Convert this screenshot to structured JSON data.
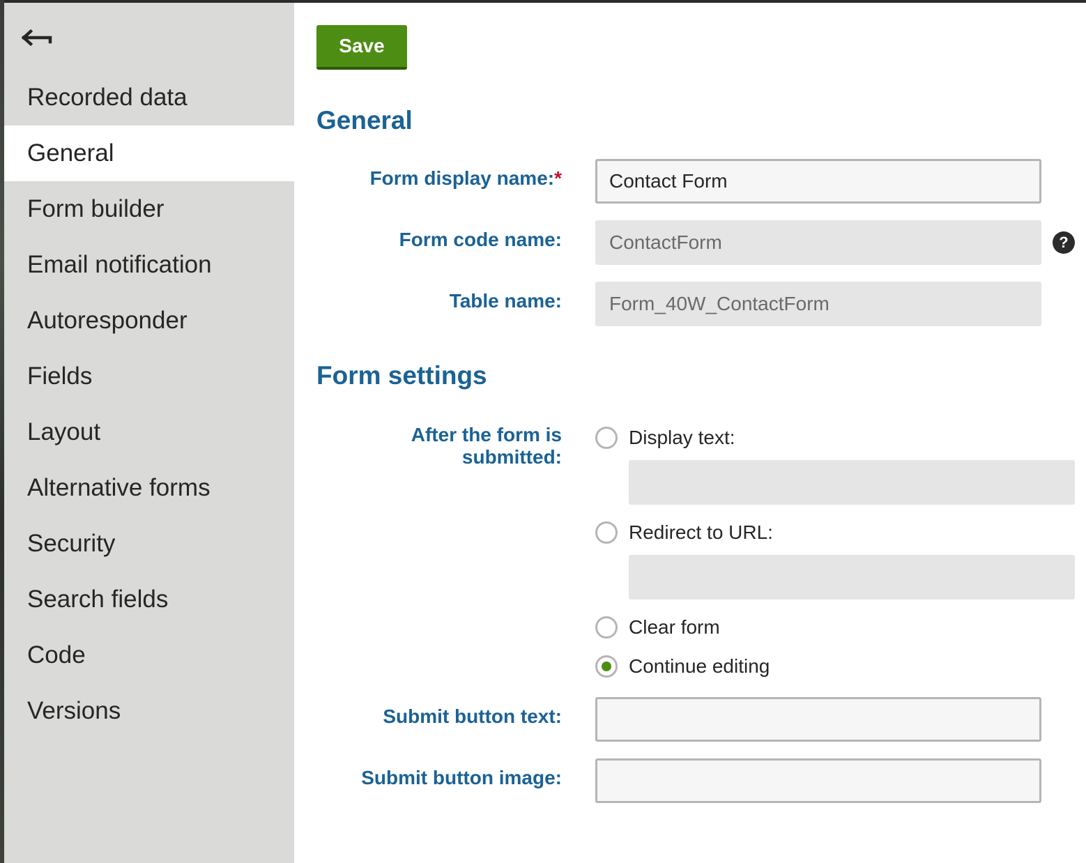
{
  "sidebar": {
    "back_icon": "back-arrow-icon",
    "items": [
      {
        "label": "Recorded data",
        "active": false
      },
      {
        "label": "General",
        "active": true
      },
      {
        "label": "Form builder",
        "active": false
      },
      {
        "label": "Email notification",
        "active": false
      },
      {
        "label": "Autoresponder",
        "active": false
      },
      {
        "label": "Fields",
        "active": false
      },
      {
        "label": "Layout",
        "active": false
      },
      {
        "label": "Alternative forms",
        "active": false
      },
      {
        "label": "Security",
        "active": false
      },
      {
        "label": "Search fields",
        "active": false
      },
      {
        "label": "Code",
        "active": false
      },
      {
        "label": "Versions",
        "active": false
      }
    ]
  },
  "toolbar": {
    "save_label": "Save"
  },
  "general": {
    "title": "General",
    "display_name": {
      "label": "Form display name:",
      "required_mark": "*",
      "value": "Contact Form"
    },
    "code_name": {
      "label": "Form code name:",
      "value": "ContactForm",
      "help_icon": "question-mark-icon",
      "help_glyph": "?"
    },
    "table_name": {
      "label": "Table name:",
      "value": "Form_40W_ContactForm"
    }
  },
  "form_settings": {
    "title": "Form settings",
    "after_submit": {
      "label": "After the form is submitted:",
      "options": [
        {
          "label": "Display text:",
          "checked": false
        },
        {
          "label": "Redirect to URL:",
          "checked": false
        },
        {
          "label": "Clear form",
          "checked": false
        },
        {
          "label": "Continue editing",
          "checked": true
        }
      ],
      "display_text_value": "",
      "redirect_url_value": ""
    },
    "submit_button_text": {
      "label": "Submit button text:",
      "value": ""
    },
    "submit_button_image": {
      "label": "Submit button image:",
      "value": ""
    }
  },
  "colors": {
    "accent_green": "#4e8d13",
    "label_blue": "#1b6295",
    "sidebar_bg": "#dadbd9",
    "required_red": "#c8102e"
  }
}
